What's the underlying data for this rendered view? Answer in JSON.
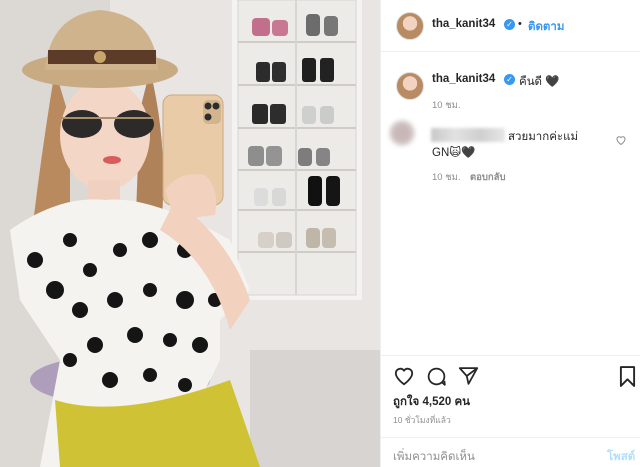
{
  "header": {
    "username": "tha_kanit34",
    "verified_icon": "verified-badge-icon",
    "separator": "•",
    "follow_label": "ติดตาม"
  },
  "caption": {
    "username": "tha_kanit34",
    "text": "คืนดี 🖤",
    "time": "10 ชม."
  },
  "comment": {
    "text_tail": "สวยมากค่ะแม่",
    "text_line2": "GN🙀🖤",
    "time": "10 ชม.",
    "reply_label": "ตอบกลับ"
  },
  "actions": {
    "like_icon": "heart-icon",
    "comment_icon": "comment-icon",
    "share_icon": "share-icon",
    "save_icon": "bookmark-icon"
  },
  "likes_text": "ถูกใจ 4,520 คน",
  "posted_time": "10 ชั่วโมงที่แล้ว",
  "comment_box": {
    "placeholder": "เพิ่มความคิดเห็น",
    "post_label": "โพสต์"
  },
  "colors": {
    "accent": "#3897f0",
    "text": "#262626",
    "muted": "#8e8e8e",
    "border": "#efefef"
  }
}
